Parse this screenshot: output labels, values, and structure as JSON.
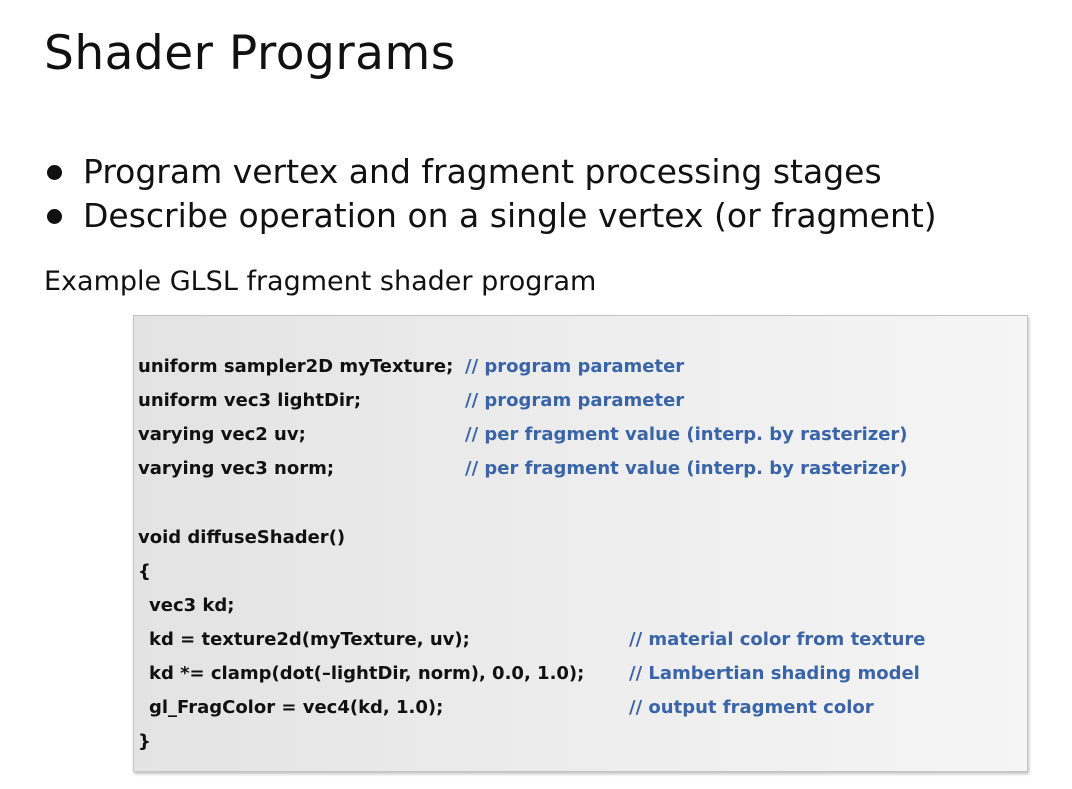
{
  "title": "Shader Programs",
  "bullets": [
    "Program vertex and fragment processing stages",
    "Describe operation on a single vertex (or fragment)"
  ],
  "subtitle": "Example GLSL fragment shader program",
  "code": {
    "lines": [
      "uniform sampler2D myTexture;",
      "uniform vec3 lightDir;",
      "varying vec2 uv;",
      "varying vec3 norm;",
      "void diffuseShader()",
      "{",
      "vec3 kd;",
      "kd = texture2d(myTexture, uv);",
      "kd *= clamp(dot(–lightDir, norm), 0.0, 1.0);",
      "gl_FragColor = vec4(kd, 1.0);",
      "}"
    ],
    "comments": [
      "// program parameter",
      "// program parameter",
      "// per fragment value (interp. by rasterizer)",
      "// per fragment value (interp. by rasterizer)",
      "// material color from texture",
      "// Lambertian shading model",
      "// output fragment color"
    ]
  },
  "colors": {
    "text": "#111111",
    "comment": "#3a64a8",
    "code_background": "#ececec"
  }
}
